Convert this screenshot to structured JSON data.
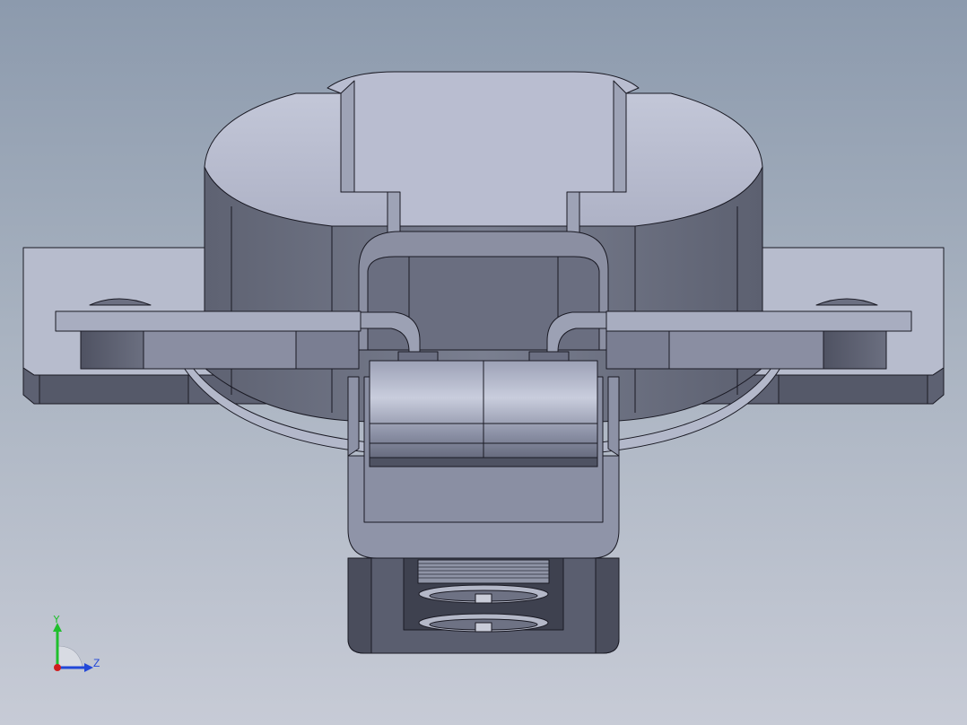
{
  "view": {
    "background_top": "#8c9aad",
    "background_bottom": "#c7cbd6",
    "edge_color": "#1a1a24"
  },
  "triad": {
    "y_label": "Y",
    "z_label": "Z",
    "y_color": "#1fbf2c",
    "z_color": "#2348d8",
    "x_color": "#d01e1e"
  }
}
